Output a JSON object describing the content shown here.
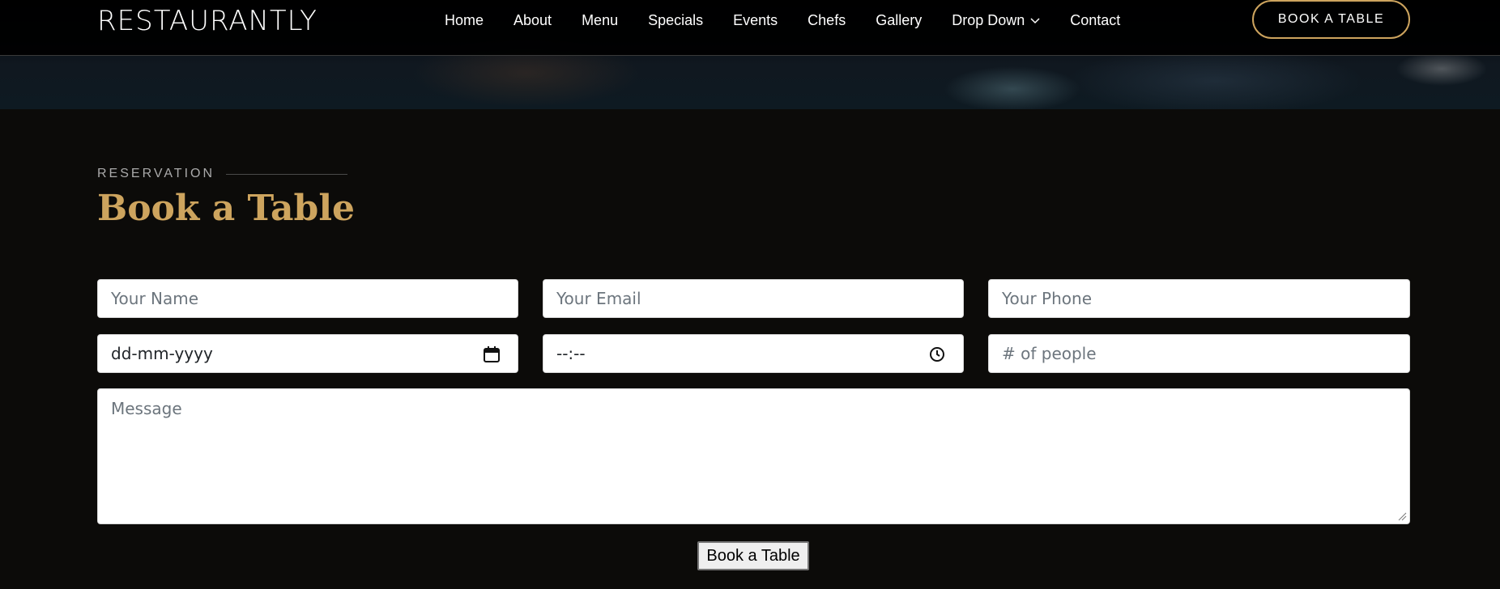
{
  "brand": {
    "logo": "RESTAURANTLY",
    "accent": "#cda45e"
  },
  "nav": {
    "items": [
      "Home",
      "About",
      "Menu",
      "Specials",
      "Events",
      "Chefs",
      "Gallery",
      "Drop Down",
      "Contact"
    ],
    "dropdown_icon": "chevron-down-icon"
  },
  "header_cta": "BOOK A TABLE",
  "section": {
    "label": "RESERVATION",
    "title": "Book a Table"
  },
  "form": {
    "name_placeholder": "Your Name",
    "email_placeholder": "Your Email",
    "phone_placeholder": "Your Phone",
    "date_value": "dd-mm-yyyy",
    "time_value": "--:--",
    "people_placeholder": "# of people",
    "message_placeholder": "Message",
    "submit_label": "Book a Table",
    "date_icon": "calendar-icon",
    "time_icon": "clock-icon"
  }
}
